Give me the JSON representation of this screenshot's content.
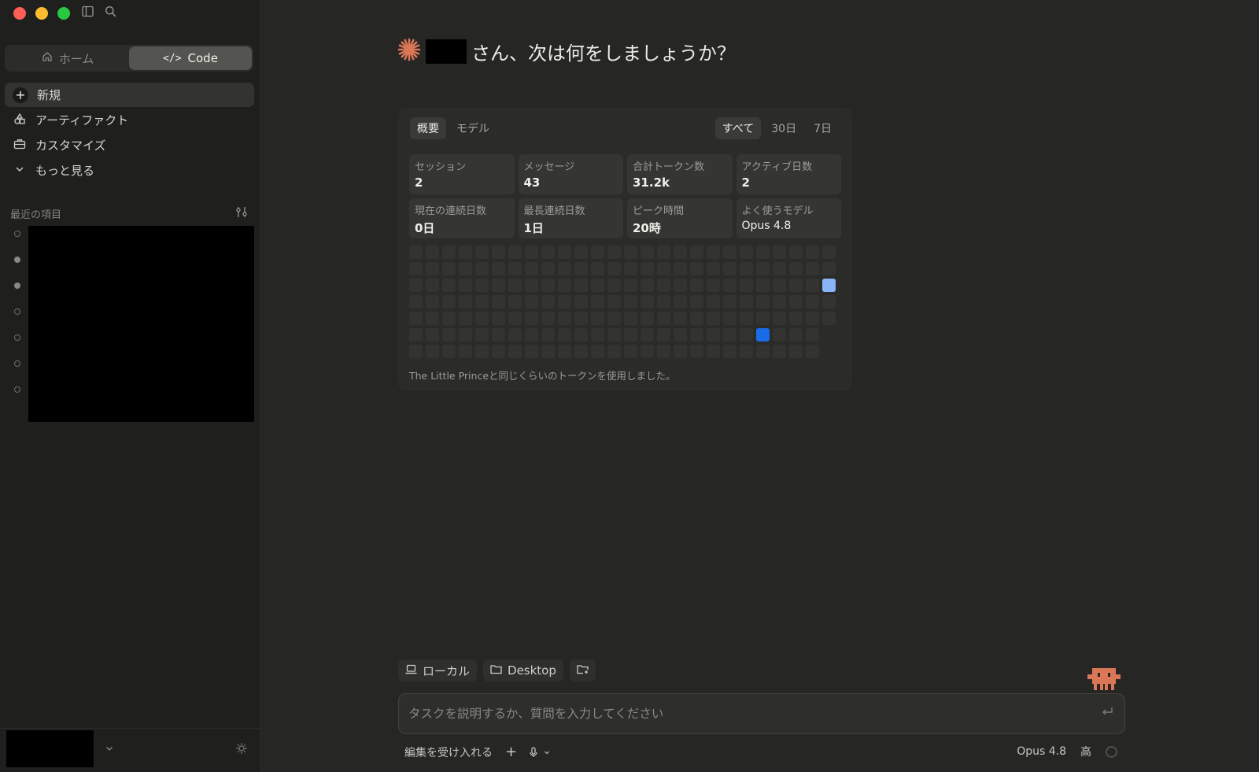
{
  "sidebar": {
    "mode_tabs": [
      {
        "label": "ホーム",
        "icon": "home-icon",
        "active": false
      },
      {
        "label": "Code",
        "icon": "code-icon",
        "active": true
      }
    ],
    "nav": [
      {
        "label": "新規",
        "icon": "plus-icon"
      },
      {
        "label": "アーティファクト",
        "icon": "artifacts-icon"
      },
      {
        "label": "カスタマイズ",
        "icon": "briefcase-icon"
      },
      {
        "label": "もっと見る",
        "icon": "chevron-down-icon"
      }
    ],
    "recent_title": "最近の項目",
    "recent_dots": [
      false,
      true,
      true,
      false,
      false,
      false,
      false
    ]
  },
  "main": {
    "greeting_suffix": "さん、次は何をしましょうか？",
    "stats": {
      "tabs_left": [
        "概要",
        "モデル"
      ],
      "tabs_right": [
        "すべて",
        "30日",
        "7日"
      ],
      "tiles": [
        {
          "label": "セッション",
          "value": "2"
        },
        {
          "label": "メッセージ",
          "value": "43"
        },
        {
          "label": "合計トークン数",
          "value": "31.2k"
        },
        {
          "label": "アクティブ日数",
          "value": "2"
        },
        {
          "label": "現在の連続日数",
          "value": "0日"
        },
        {
          "label": "最長連続日数",
          "value": "1日"
        },
        {
          "label": "ピーク時間",
          "value": "20時"
        },
        {
          "label": "よく使うモデル",
          "value": "Opus 4.8"
        }
      ],
      "heatmap": {
        "columns": 26,
        "rows": 7,
        "last_column_rows": 5,
        "active_cells": [
          {
            "col": 25,
            "row": 2,
            "level": 1,
            "color": "#8ab4f8"
          },
          {
            "col": 21,
            "row": 5,
            "level": 2,
            "color": "#1a6be6"
          }
        ]
      },
      "footer": "The Little Princeと同じくらいのトークンを使用しました。"
    }
  },
  "composer": {
    "chips": [
      {
        "label": "ローカル",
        "icon": "laptop-icon"
      },
      {
        "label": "Desktop",
        "icon": "folder-icon"
      },
      {
        "label": "",
        "icon": "folder-add-icon"
      }
    ],
    "placeholder": "タスクを説明するか、質問を入力してください",
    "accept_edits": "編集を受け入れる",
    "model": "Opus 4.8",
    "effort": "高"
  },
  "colors": {
    "accent": "#d97757",
    "heat_low": "#8ab4f8",
    "heat_high": "#1a6be6"
  }
}
